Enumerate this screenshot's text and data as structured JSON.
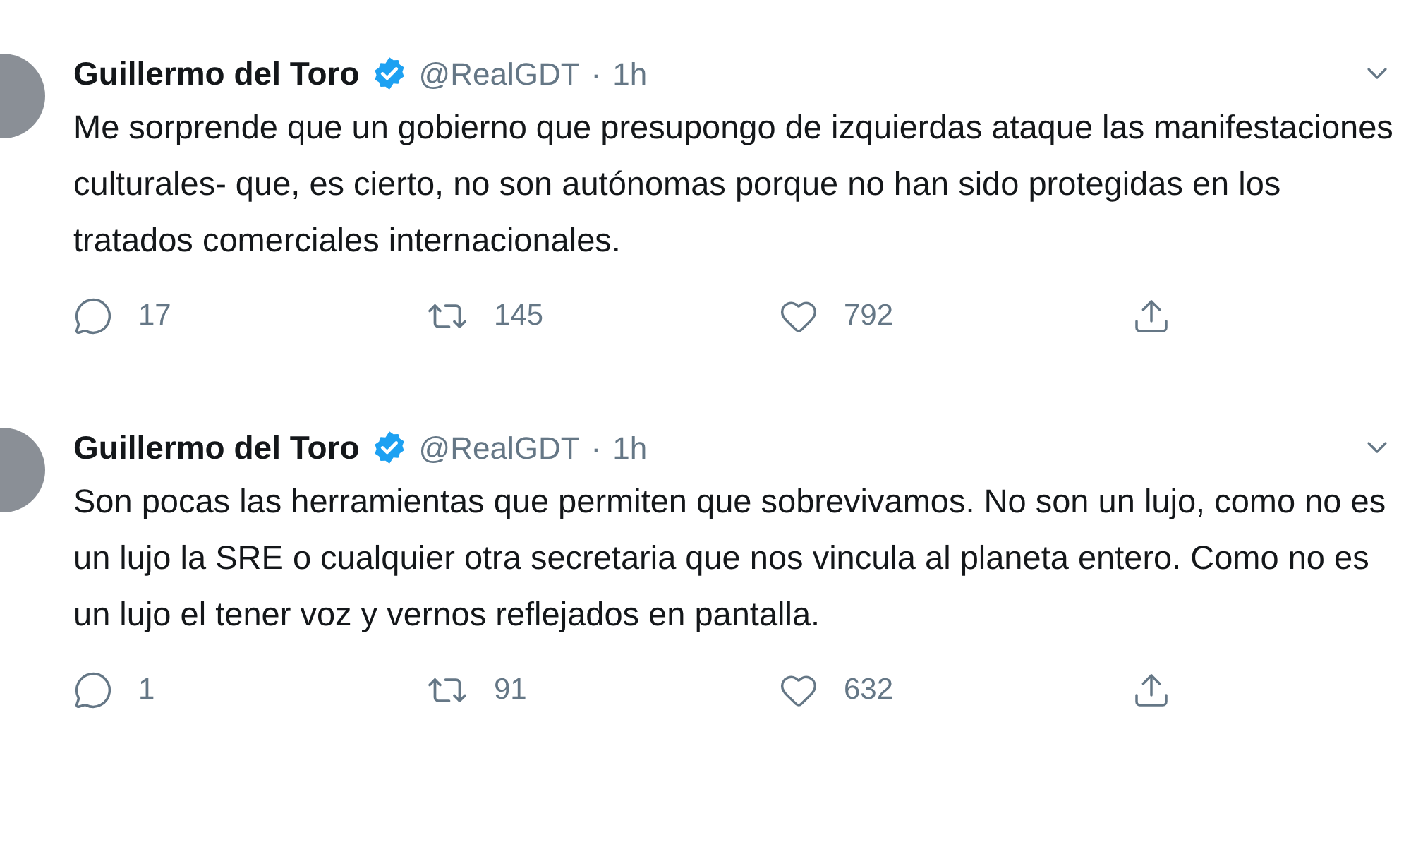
{
  "tweets": [
    {
      "name": "Guillermo del Toro",
      "handle": "@RealGDT",
      "separator": "·",
      "time": "1h",
      "verified": true,
      "text": "Me sorprende que un gobierno que presupongo de izquierdas ataque las manifestaciones culturales- que, es cierto, no son autónomas porque no han sido protegidas en los tratados comerciales internacionales.",
      "replies": "17",
      "retweets": "145",
      "likes": "792"
    },
    {
      "name": "Guillermo del Toro",
      "handle": "@RealGDT",
      "separator": "·",
      "time": "1h",
      "verified": true,
      "text": "Son pocas las herramientas que permiten que sobrevivamos. No son un lujo, como no es un lujo la SRE o cualquier otra secretaria que nos vincula al planeta entero. Como no es un lujo el tener voz y vernos reflejados en pantalla.",
      "replies": "1",
      "retweets": "91",
      "likes": "632"
    }
  ]
}
